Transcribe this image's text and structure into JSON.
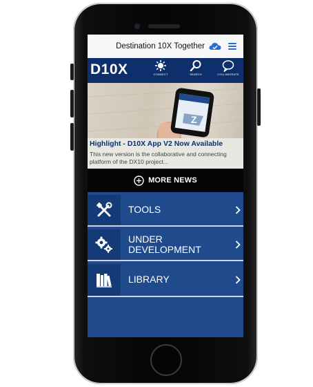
{
  "header": {
    "title": "Destination 10X Together"
  },
  "navbar": {
    "logo": "D10X",
    "items": [
      {
        "label": "CONNECT",
        "icon": "connect-icon"
      },
      {
        "label": "SEARCH",
        "icon": "search-icon"
      },
      {
        "label": "COLLABORATE",
        "icon": "chat-bubble-icon"
      }
    ]
  },
  "news": {
    "title": "Highlight - D10X App V2 Now Available",
    "body": "This new version is the collaborative and connecting platform of the DX10 project..."
  },
  "more_news": {
    "label": "MORE NEWS"
  },
  "menu": [
    {
      "label": "TOOLS",
      "icon": "tools-icon"
    },
    {
      "label": "UNDER DEVELOPMENT",
      "icon": "gears-icon"
    },
    {
      "label": "LIBRARY",
      "icon": "books-icon"
    }
  ],
  "colors": {
    "brand_dark": "#0d2f6b",
    "brand": "#1f4a8c",
    "accent": "#2a6dd1"
  }
}
